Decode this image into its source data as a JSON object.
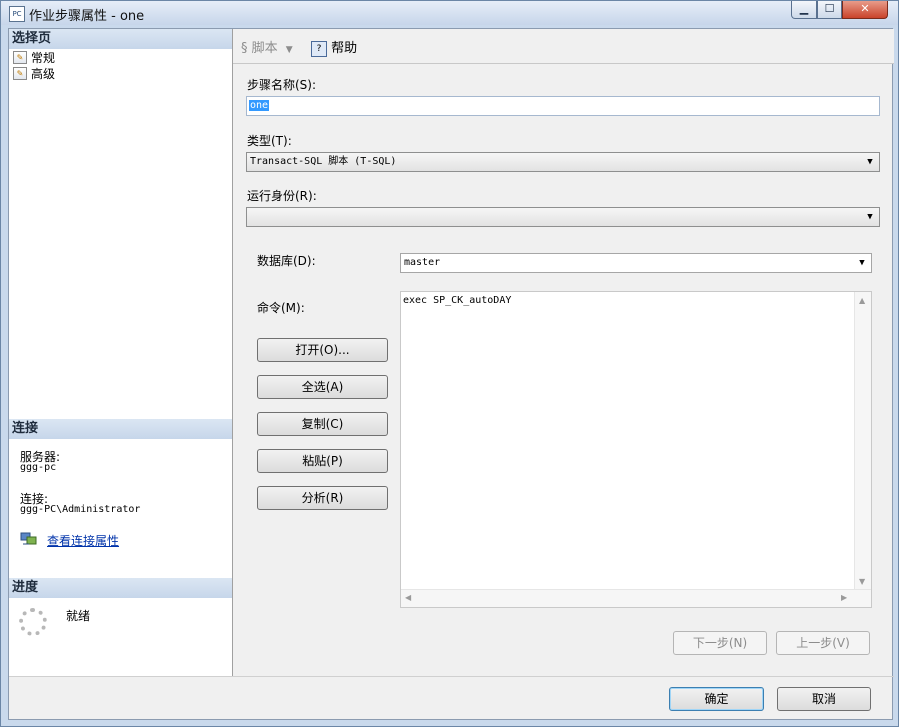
{
  "window": {
    "title": "作业步骤属性 - one",
    "app_icon": "PC",
    "minimize": "▁",
    "maximize": "☐",
    "close": "✕"
  },
  "left": {
    "select_page": {
      "header": "选择页",
      "items": [
        {
          "label": "常规",
          "icon": "page-icon"
        },
        {
          "label": "高级",
          "icon": "page-icon"
        }
      ]
    },
    "connection": {
      "header": "连接",
      "server_label": "服务器:",
      "server_value": "ggg-pc",
      "conn_label": "连接:",
      "conn_value": "ggg-PC\\Administrator",
      "view_props_link": "查看连接属性"
    },
    "progress": {
      "header": "进度",
      "status": "就绪"
    }
  },
  "toolbar": {
    "script_label": "脚本",
    "help_label": "帮助"
  },
  "form": {
    "step_name_label": "步骤名称(S):",
    "step_name_value": "one",
    "type_label": "类型(T):",
    "type_value": "Transact-SQL 脚本 (T-SQL)",
    "run_as_label": "运行身份(R):",
    "run_as_value": "",
    "database_label": "数据库(D):",
    "database_value": "master",
    "command_label": "命令(M):",
    "command_value": "exec SP_CK_autoDAY",
    "buttons": {
      "open": "打开(O)...",
      "select_all": "全选(A)",
      "copy": "复制(C)",
      "paste": "粘贴(P)",
      "parse": "分析(R)"
    },
    "next_step": "下一步(N)",
    "prev_step": "上一步(V)"
  },
  "footer": {
    "ok": "确定",
    "cancel": "取消"
  }
}
